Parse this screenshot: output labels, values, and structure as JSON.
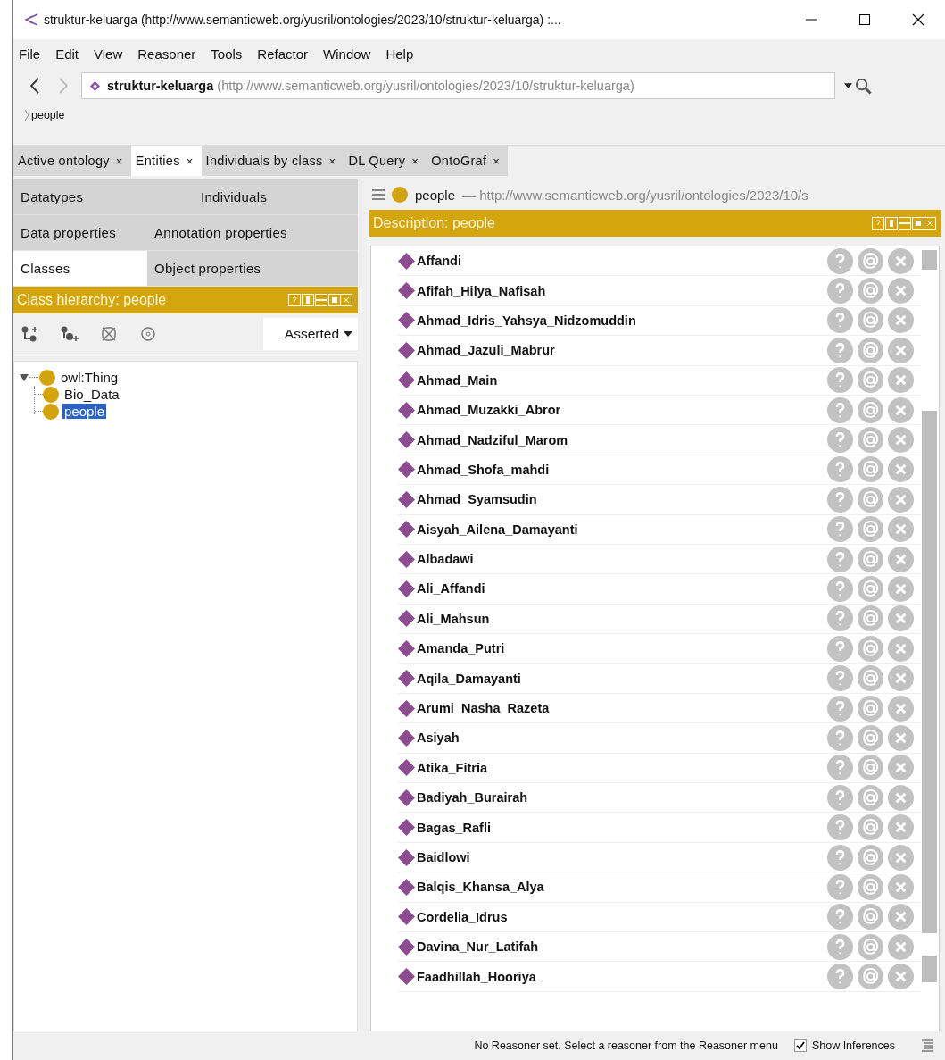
{
  "window": {
    "title": "struktur-keluarga (http://www.semanticweb.org/yusril/ontologies/2023/10/struktur-keluarga) :..."
  },
  "menu": [
    {
      "label": "File",
      "selected": false
    },
    {
      "label": "Edit",
      "selected": false
    },
    {
      "label": "View",
      "selected": false
    },
    {
      "label": "Reasoner",
      "selected": false
    },
    {
      "label": "Tools",
      "selected": false
    },
    {
      "label": "Refactor",
      "selected": false
    },
    {
      "label": "Window",
      "selected": false
    },
    {
      "label": "Help",
      "selected": false
    }
  ],
  "address": {
    "name": "struktur-keluarga",
    "iri": "(http://www.semanticweb.org/yusril/ontologies/2023/10/struktur-keluarga)"
  },
  "breadcrumb": "people",
  "tabs": [
    {
      "label": "Active ontology",
      "close": "×",
      "selected": false
    },
    {
      "label": "Entities",
      "close": "×",
      "selected": true
    },
    {
      "label": "Individuals by class",
      "close": "×",
      "selected": false
    },
    {
      "label": "DL Query",
      "close": "×",
      "selected": false
    },
    {
      "label": "OntoGraf",
      "close": "×",
      "selected": false
    }
  ],
  "entity_tabs": [
    [
      {
        "label": "Datatypes",
        "selected": false
      },
      {
        "label": "Individuals",
        "selected": false
      }
    ],
    [
      {
        "label": "Data properties",
        "selected": false
      },
      {
        "label": "Annotation properties",
        "selected": false
      }
    ],
    [
      {
        "label": "Classes",
        "selected": true
      },
      {
        "label": "Object properties",
        "selected": false
      }
    ]
  ],
  "class_hierarchy": {
    "title": "Class hierarchy: people",
    "mode": "Asserted",
    "tree": [
      {
        "label": "owl:Thing",
        "expanded": true,
        "selected": false,
        "children": [
          {
            "label": "Bio_Data",
            "selected": false
          },
          {
            "label": "people",
            "selected": true
          }
        ]
      }
    ]
  },
  "entity_header": {
    "name": "people",
    "separator": "—",
    "iri": "http://www.semanticweb.org/yusril/ontologies/2023/10/s"
  },
  "description": {
    "title": "Description: people",
    "individuals": [
      "Affandi",
      "Afifah_Hilya_Nafisah",
      "Ahmad_Idris_Yahsya_Nidzomuddin",
      "Ahmad_Jazuli_Mabrur",
      "Ahmad_Main",
      "Ahmad_Muzakki_Abror",
      "Ahmad_Nadziful_Marom",
      "Ahmad_Shofa_mahdi",
      "Ahmad_Syamsudin",
      "Aisyah_Ailena_Damayanti",
      "Albadawi",
      "Ali_Affandi",
      "Ali_Mahsun",
      "Amanda_Putri",
      "Aqila_Damayanti",
      "Arumi_Nasha_Razeta",
      "Asiyah",
      "Atika_Fitria",
      "Badiyah_Burairah",
      "Bagas_Rafli",
      "Baidlowi",
      "Balqis_Khansa_Alya",
      "Cordelia_Idrus",
      "Davina_Nur_Latifah",
      "Faadhillah_Hooriya"
    ]
  },
  "status_bar": {
    "message": "No Reasoner set. Select a reasoner from the Reasoner menu",
    "show_inferences": {
      "label": "Show Inferences",
      "checked": true
    }
  }
}
